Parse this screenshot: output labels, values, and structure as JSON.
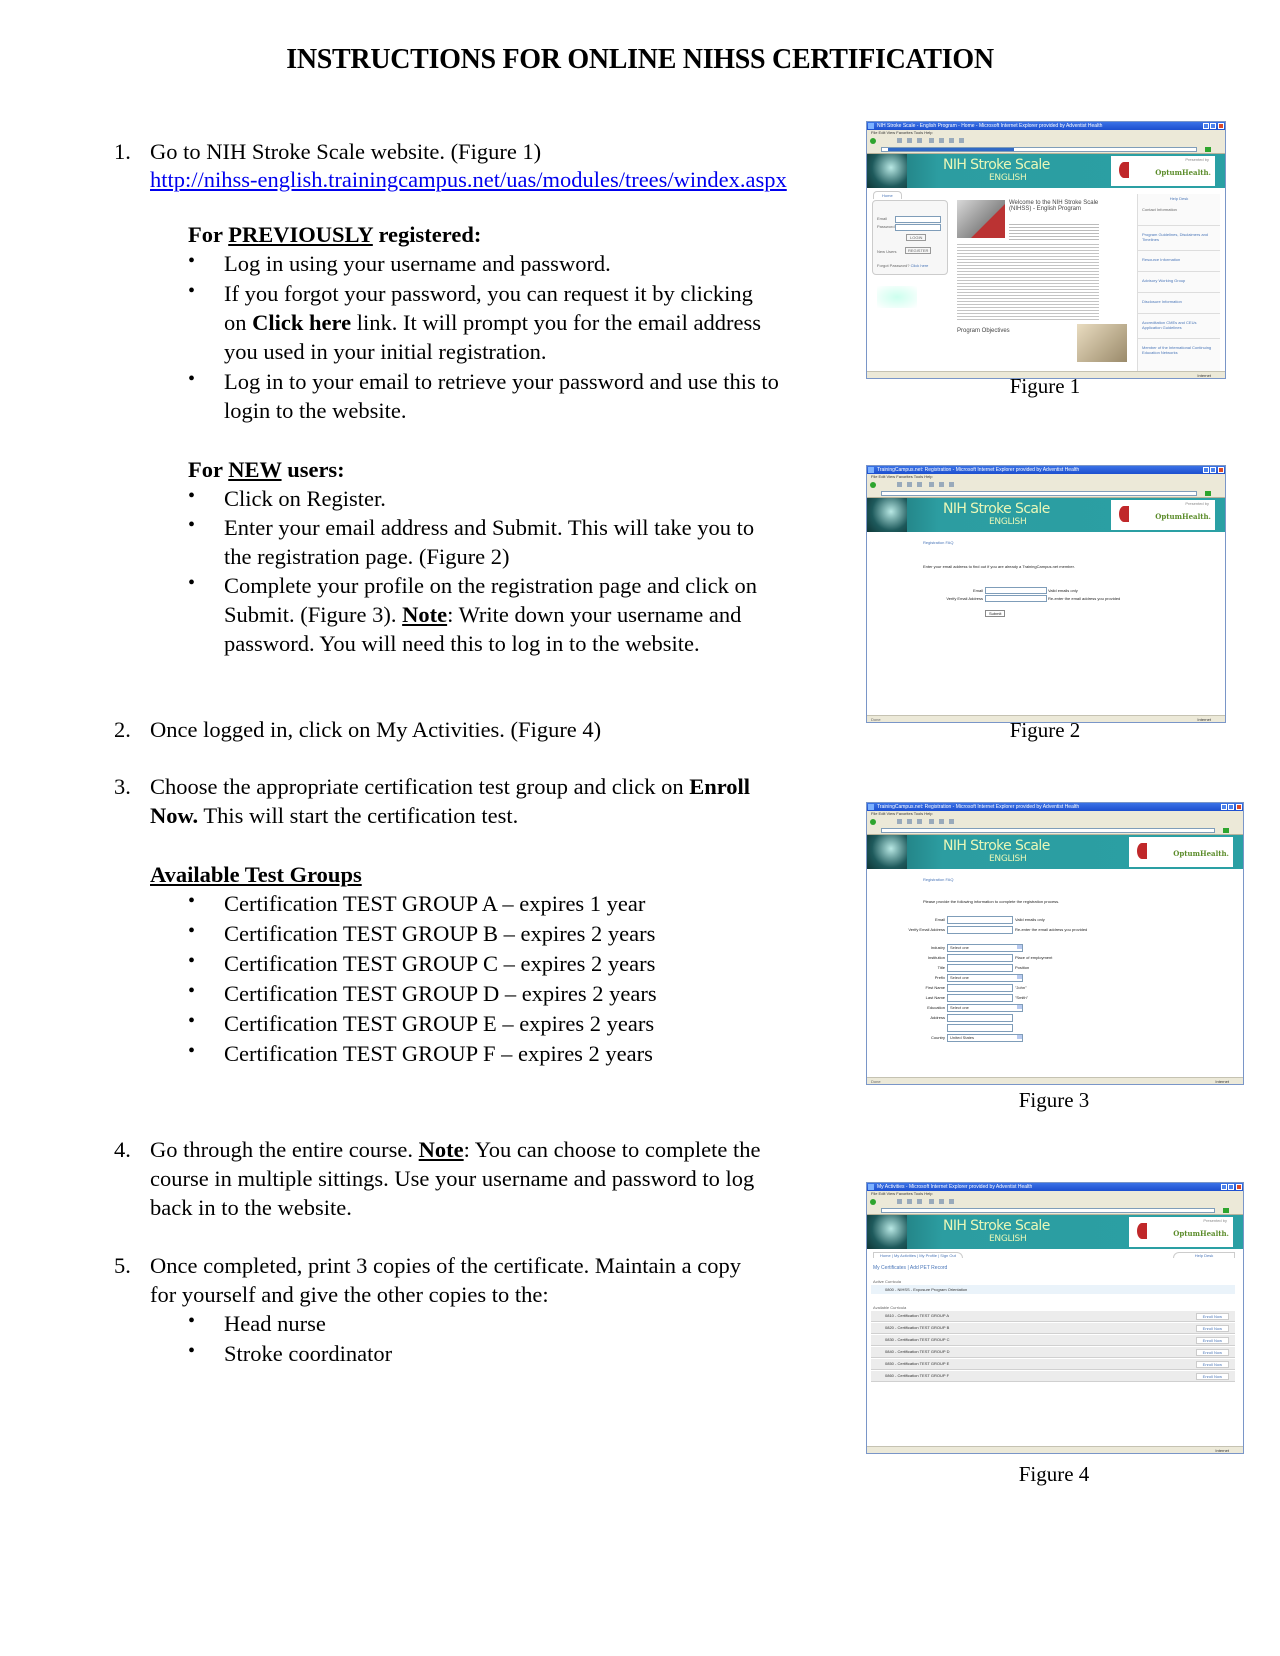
{
  "title": "INSTRUCTIONS FOR ONLINE NIHSS CERTIFICATION",
  "steps": {
    "s1": {
      "num": "1.",
      "text": "Go to NIH Stroke Scale website. (Figure 1)",
      "link": "http://nihss-english.trainingcampus.net/uas/modules/trees/windex.aspx",
      "previously": {
        "heading_pre": "For ",
        "heading_u": "PREVIOUSLY",
        "heading_post": " registered:",
        "b1": "Log in using your username and password.",
        "b2_l1": "If you forgot your password, you can request it by clicking",
        "b2_l2_pre": "on ",
        "b2_l2_bold": "Click here",
        "b2_l2_post": " link.  It will prompt you for the email address",
        "b2_l3": "you used in your initial registration.",
        "b3_l1": "Log in to your email to retrieve your password and use this to",
        "b3_l2": "login to the website."
      },
      "new_users": {
        "heading_pre": "For ",
        "heading_u": "NEW",
        "heading_post": " users:",
        "b1": "Click on Register.",
        "b2_l1": "Enter your email address and Submit. This will take you to",
        "b2_l2": "the registration page. (Figure 2)",
        "b3_l1": "Complete your profile on the registration page and click on",
        "b3_l2_pre": "Submit. (Figure 3).  ",
        "b3_l2_note": "Note",
        "b3_l2_post": ":  Write down your username and",
        "b3_l3": "password.  You will need this to log in to the website."
      }
    },
    "s2": {
      "num": "2.",
      "text": "Once logged in, click on My Activities. (Figure 4)"
    },
    "s3": {
      "num": "3.",
      "l1_pre": "Choose the appropriate certification test group and click on ",
      "l1_bold": "Enroll",
      "l2_bold": "Now.",
      "l2_post": "  This will start the certification test.",
      "groups_heading": "Available Test Groups",
      "groups": [
        "Certification TEST GROUP A – expires 1 year",
        "Certification TEST GROUP B  – expires 2 years",
        "Certification TEST GROUP C  – expires 2 years",
        "Certification TEST GROUP D – expires 2 years",
        "Certification TEST GROUP E – expires 2 years",
        "Certification TEST GROUP F – expires 2 years"
      ]
    },
    "s4": {
      "num": "4.",
      "l1_pre": "Go through the entire course.  ",
      "l1_note": "Note",
      "l1_post": ": You can choose to complete the",
      "l2": "course in multiple sittings. Use your username and password to log",
      "l3": "back in to the website."
    },
    "s5": {
      "num": "5.",
      "l1": "Once completed, print 3 copies of the certificate. Maintain a copy",
      "l2": "for yourself and give the other copies to the:",
      "recipients": [
        "Head nurse",
        "Stroke coordinator"
      ]
    }
  },
  "bullet_glyph": "•",
  "figures": {
    "f1": {
      "caption": "Figure 1",
      "window_title": "NIH Stroke Scale - English Program - Home - Microsoft Internet Explorer provided by Adventist Health",
      "menu": "File  Edit  View  Favorites  Tools  Help",
      "banner_title": "NIH Stroke Scale",
      "banner_sub": "ENGLISH",
      "presented_by": "Presented by",
      "optum": "OptumHealth.",
      "tab_home": "Home",
      "login_email": "Email",
      "login_password": "Password",
      "login_button": "LOGIN",
      "new_users": "New Users",
      "register_button": "REGISTER",
      "forgot": "Forgot Password?",
      "click_here": "Click here",
      "welcome": "Welcome to the NIH Stroke Scale (NIHSS) - English Program",
      "objectives": "Program Objectives",
      "help_desk": "Help Desk",
      "right_links": [
        "Contact Information",
        "Program Guidelines, Disclaimers and Timelines",
        "Resource Information",
        "Advisory Working Group",
        "Disclosure Information",
        "Accreditation CMEs and CEUs Application Guidelines",
        "Member of the International Continuing Education Networks"
      ],
      "status": "Internet"
    },
    "f2": {
      "caption": "Figure 2",
      "window_title": "TrainingCampus.net: Registration - Microsoft Internet Explorer provided by Adventist Health",
      "menu": "File  Edit  View  Favorites  Tools  Help",
      "banner_title": "NIH Stroke Scale",
      "banner_sub": "ENGLISH",
      "presented_by": "Presented by",
      "optum": "OptumHealth.",
      "faq": "Registration FAQ",
      "intro": "Enter your email address to find out if you are already a TrainingCampus.net member.",
      "email_label": "Email",
      "email_hint": "Valid emails only",
      "verify_label": "Verify Email Address",
      "verify_hint": "Re-enter the email address you provided",
      "submit": "Submit",
      "status_left": "Done",
      "status": "Internet"
    },
    "f3": {
      "caption": "Figure 3",
      "window_title": "TrainingCampus.net: Registration - Microsoft Internet Explorer provided by Adventist Health",
      "menu": "File  Edit  View  Favorites  Tools  Help",
      "banner_title": "NIH Stroke Scale",
      "banner_sub": "ENGLISH",
      "optum": "OptumHealth.",
      "faq": "Registration FAQ",
      "intro": "Please provide the following information to complete the registration process.",
      "fields": [
        {
          "label": "Email",
          "hint": "Valid emails only",
          "type": "text"
        },
        {
          "label": "Verify Email Address",
          "hint": "Re-enter the email address you provided",
          "type": "text"
        },
        {
          "label": "Industry",
          "hint": "",
          "type": "select",
          "value": "Select one"
        },
        {
          "label": "Institution",
          "hint": "Place of employment",
          "type": "text"
        },
        {
          "label": "Title",
          "hint": "Position",
          "type": "text"
        },
        {
          "label": "Prefix",
          "hint": "",
          "type": "select",
          "value": "Select one"
        },
        {
          "label": "First Name",
          "hint": "\"John\"",
          "type": "text"
        },
        {
          "label": "Last Name",
          "hint": "\"Smith\"",
          "type": "text"
        },
        {
          "label": "Education",
          "hint": "",
          "type": "select",
          "value": "Select one"
        },
        {
          "label": "Address",
          "hint": "",
          "type": "text"
        },
        {
          "label": "",
          "hint": "",
          "type": "text"
        },
        {
          "label": "Country",
          "hint": "",
          "type": "select",
          "value": "United States"
        }
      ],
      "status_left": "Done",
      "status": "Internet"
    },
    "f4": {
      "caption": "Figure 4",
      "window_title": "My Activities - Microsoft Internet Explorer provided by Adventist Health",
      "menu": "File  Edit  View  Favorites  Tools  Help",
      "banner_title": "NIH Stroke Scale",
      "banner_sub": "ENGLISH",
      "presented_by": "Presented by",
      "optum": "OptumHealth.",
      "nav": [
        "Home",
        "My Activities",
        "My Profile",
        "Sign Out"
      ],
      "help_desk": "Help Desk",
      "sublinks": "My Certificates  |  Add PET Record",
      "active_heading": "Active Curricula",
      "active_item": "0800 - NIHSS - Exposure Program Orientation",
      "available_heading": "Available Curricula",
      "available": [
        "0810 - Certification TEST GROUP A",
        "0820 - Certification TEST GROUP B",
        "0830 - Certification TEST GROUP C",
        "0840 - Certification TEST GROUP D",
        "0850 - Certification TEST GROUP E",
        "0860 - Certification TEST GROUP F"
      ],
      "enroll_label": "Enroll Now",
      "status": "Internet"
    }
  }
}
